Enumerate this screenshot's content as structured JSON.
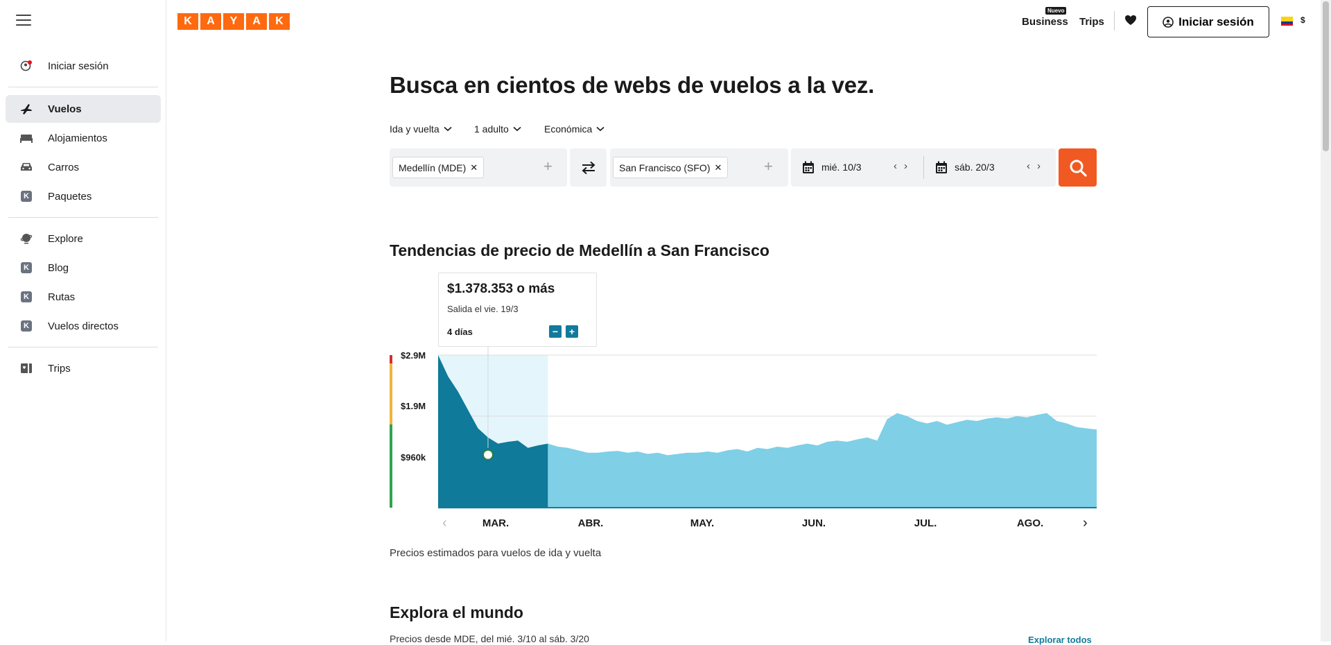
{
  "sidebar": {
    "signin": "Iniciar sesión",
    "items": [
      {
        "label": "Vuelos",
        "icon": "plane-icon"
      },
      {
        "label": "Alojamientos",
        "icon": "bed-icon"
      },
      {
        "label": "Carros",
        "icon": "car-icon"
      },
      {
        "label": "Paquetes",
        "icon": "k-icon"
      },
      {
        "label": "Explore",
        "icon": "globe-icon"
      },
      {
        "label": "Blog",
        "icon": "k-icon"
      },
      {
        "label": "Rutas",
        "icon": "k-icon"
      },
      {
        "label": "Vuelos directos",
        "icon": "k-icon"
      },
      {
        "label": "Trips",
        "icon": "trips-icon"
      }
    ]
  },
  "header": {
    "logo": [
      "K",
      "A",
      "Y",
      "A",
      "K"
    ],
    "badge": "Nuevo",
    "business": "Business",
    "trips": "Trips",
    "signin": "Iniciar sesión",
    "currency": "$",
    "accent": "#ff690f"
  },
  "search": {
    "title": "Busca en cientos de webs de vuelos a la vez.",
    "trip_type": "Ida y vuelta",
    "travelers": "1 adulto",
    "cabin": "Económica",
    "origin": "Medellín (MDE)",
    "destination": "San Francisco (SFO)",
    "depart_date": "mié. 10/3",
    "return_date": "sáb. 20/3"
  },
  "trends": {
    "title": "Tendencias de precio de Medellín a San Francisco",
    "tooltip_price": "$1.378.353 o más",
    "tooltip_date": "Salida el vie. 19/3",
    "tooltip_duration": "4 días",
    "minus": "−",
    "plus": "+",
    "note": "Precios estimados para vuelos de ida y vuelta"
  },
  "chart_data": {
    "type": "area",
    "y_ticks": [
      "$2.9M",
      "$1.9M",
      "$960k"
    ],
    "months": [
      "MAR.",
      "ABR.",
      "MAY.",
      "JUN.",
      "JUL.",
      "AGO."
    ],
    "highlighted_range": [
      "MAR. 1",
      "MAR. 31"
    ],
    "values_millions": [
      2.9,
      2.55,
      2.3,
      2.0,
      1.7,
      1.55,
      1.45,
      1.48,
      1.5,
      1.38,
      1.42,
      1.45,
      1.4,
      1.38,
      1.34,
      1.3,
      1.3,
      1.32,
      1.33,
      1.3,
      1.32,
      1.28,
      1.3,
      1.26,
      1.28,
      1.3,
      1.3,
      1.32,
      1.3,
      1.34,
      1.36,
      1.32,
      1.38,
      1.36,
      1.4,
      1.38,
      1.42,
      1.45,
      1.42,
      1.48,
      1.5,
      1.48,
      1.52,
      1.55,
      1.5,
      1.85,
      1.95,
      1.9,
      1.82,
      1.78,
      1.82,
      1.76,
      1.8,
      1.84,
      1.82,
      1.86,
      1.88,
      1.86,
      1.9,
      1.88,
      1.92,
      1.95,
      1.82,
      1.78,
      1.72,
      1.7,
      1.68
    ]
  },
  "explore": {
    "title": "Explora el mundo",
    "subtitle": "Precios desde MDE, del mié. 3/10 al sáb. 3/20",
    "link": "Explorar todos"
  }
}
